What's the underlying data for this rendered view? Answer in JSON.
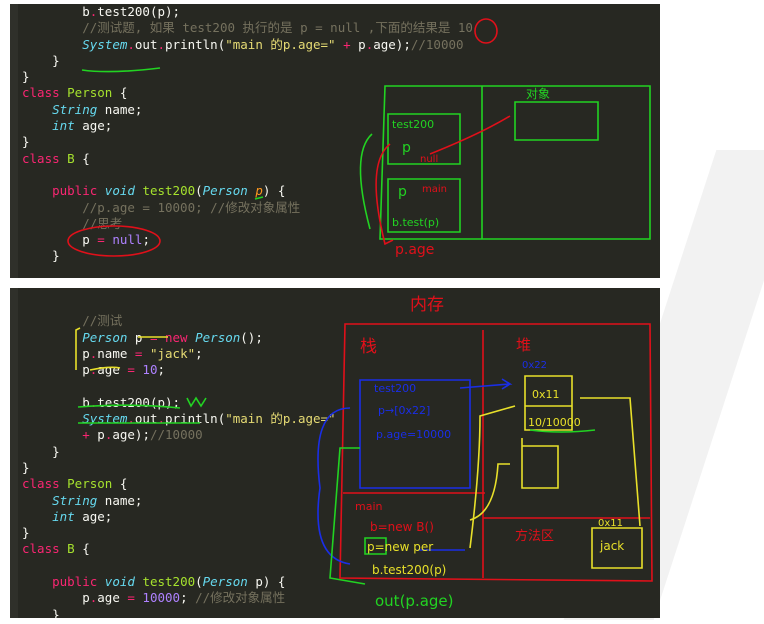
{
  "top_panel": {
    "lines": [
      [
        [
          "        b",
          "t"
        ],
        [
          ".",
          "op"
        ],
        [
          "test200(p);",
          "t"
        ]
      ],
      [
        [
          "        //测试题, 如果 test200 执行的是 p = null ,下面的结果是 ",
          "cm"
        ],
        [
          "10",
          "cm"
        ]
      ],
      [
        [
          "        ",
          "t"
        ],
        [
          "System",
          "ty"
        ],
        [
          ".",
          "op"
        ],
        [
          "out",
          "t"
        ],
        [
          ".",
          "op"
        ],
        [
          "println(",
          "t"
        ],
        [
          "\"main 的p.age=\"",
          "str"
        ],
        [
          " + ",
          "op"
        ],
        [
          "p",
          "t"
        ],
        [
          ".",
          "op"
        ],
        [
          "age);",
          "t"
        ],
        [
          "//10000",
          "cm"
        ]
      ],
      [
        [
          "    }",
          "t"
        ]
      ],
      [
        [
          "}",
          "t"
        ]
      ],
      [
        [
          "class ",
          "kw"
        ],
        [
          "Person",
          "fn"
        ],
        [
          " {",
          "t"
        ]
      ],
      [
        [
          "    ",
          "t"
        ],
        [
          "String",
          "ty"
        ],
        [
          " name;",
          "t"
        ]
      ],
      [
        [
          "    ",
          "t"
        ],
        [
          "int",
          "ty"
        ],
        [
          " age;",
          "t"
        ]
      ],
      [
        [
          "}",
          "t"
        ]
      ],
      [
        [
          "class ",
          "kw"
        ],
        [
          "B",
          "fn"
        ],
        [
          " {",
          "t"
        ]
      ],
      [
        [
          "",
          "t"
        ]
      ],
      [
        [
          "    public ",
          "kw"
        ],
        [
          "void ",
          "ty"
        ],
        [
          "test200",
          "fn"
        ],
        [
          "(",
          "t"
        ],
        [
          "Person ",
          "ty"
        ],
        [
          "p",
          "par"
        ],
        [
          ") {",
          "t"
        ]
      ],
      [
        [
          "        //p.age = 10000; //修改对象属性",
          "cm"
        ]
      ],
      [
        [
          "        //思考",
          "cm"
        ]
      ],
      [
        [
          "        p ",
          "t"
        ],
        [
          "=",
          "op"
        ],
        [
          " null",
          "num"
        ],
        [
          ";",
          "t"
        ]
      ],
      [
        [
          "    }",
          "t"
        ]
      ]
    ],
    "annotations": {
      "object": "对象",
      "frame_test200": "test200",
      "p1": "p",
      "null": "null",
      "p2": "p",
      "main": "main",
      "call": "b.test(p)",
      "page": "p.age"
    }
  },
  "bottom_panel": {
    "lines": [
      [
        [
          "",
          "t"
        ]
      ],
      [
        [
          "        //测试",
          "cm"
        ]
      ],
      [
        [
          "        ",
          "t"
        ],
        [
          "Person",
          "ty"
        ],
        [
          " p ",
          "t"
        ],
        [
          "=",
          "op"
        ],
        [
          " new ",
          "kw"
        ],
        [
          "Person",
          "ty"
        ],
        [
          "();",
          "t"
        ]
      ],
      [
        [
          "        p",
          "t"
        ],
        [
          ".",
          "op"
        ],
        [
          "name ",
          "t"
        ],
        [
          "=",
          "op"
        ],
        [
          " \"jack\"",
          "str"
        ],
        [
          ";",
          "t"
        ]
      ],
      [
        [
          "        p",
          "t"
        ],
        [
          ".",
          "op"
        ],
        [
          "age ",
          "t"
        ],
        [
          "=",
          "op"
        ],
        [
          " 10",
          "num"
        ],
        [
          ";",
          "t"
        ]
      ],
      [
        [
          "",
          "t"
        ]
      ],
      [
        [
          "        b",
          "t"
        ],
        [
          ".",
          "op"
        ],
        [
          "test200(p);",
          "t"
        ]
      ],
      [
        [
          "        ",
          "t"
        ],
        [
          "System",
          "ty"
        ],
        [
          ".",
          "op"
        ],
        [
          "out",
          "t"
        ],
        [
          ".",
          "op"
        ],
        [
          "println(",
          "t"
        ],
        [
          "\"main 的p.age=\"",
          "str"
        ]
      ],
      [
        [
          "        ",
          "op"
        ],
        [
          "+ ",
          "op"
        ],
        [
          "p",
          "t"
        ],
        [
          ".",
          "op"
        ],
        [
          "age);",
          "t"
        ],
        [
          "//10000",
          "cm"
        ]
      ],
      [
        [
          "    }",
          "t"
        ]
      ],
      [
        [
          "}",
          "t"
        ]
      ],
      [
        [
          "class ",
          "kw"
        ],
        [
          "Person",
          "fn"
        ],
        [
          " {",
          "t"
        ]
      ],
      [
        [
          "    ",
          "t"
        ],
        [
          "String",
          "ty"
        ],
        [
          " name;",
          "t"
        ]
      ],
      [
        [
          "    ",
          "t"
        ],
        [
          "int",
          "ty"
        ],
        [
          " age;",
          "t"
        ]
      ],
      [
        [
          "}",
          "t"
        ]
      ],
      [
        [
          "class ",
          "kw"
        ],
        [
          "B",
          "fn"
        ],
        [
          " {",
          "t"
        ]
      ],
      [
        [
          "",
          "t"
        ]
      ],
      [
        [
          "    public ",
          "kw"
        ],
        [
          "void ",
          "ty"
        ],
        [
          "test200",
          "fn"
        ],
        [
          "(",
          "t"
        ],
        [
          "Person ",
          "ty"
        ],
        [
          "p",
          "t"
        ],
        [
          ") {",
          "t"
        ]
      ],
      [
        [
          "        p",
          "t"
        ],
        [
          ".",
          "op"
        ],
        [
          "age ",
          "t"
        ],
        [
          "=",
          "op"
        ],
        [
          " 10000",
          "num"
        ],
        [
          "; ",
          "t"
        ],
        [
          "//修改对象属性",
          "cm"
        ]
      ],
      [
        [
          "    }",
          "t"
        ]
      ]
    ],
    "annotations": {
      "memory": "内存",
      "stack": "栈",
      "heap": "堆",
      "method_area": "方法区",
      "addr_obj": "0x22",
      "field_name_ref": "0x11",
      "field_age": "10/10000",
      "frame_test200": "test200",
      "p_ref": "p→[0x22]",
      "p_age": "p.age=10000",
      "main": "main",
      "b_new": "b=new B()",
      "p_new": "p=new per",
      "call": "b.test200(p)",
      "out": "out(p.age)",
      "str_addr": "0x11",
      "str_val": "jack",
      "checks": "✓✓"
    }
  },
  "colors": {
    "bg": "#272822",
    "red": "#e0101a",
    "green": "#22d322",
    "blue": "#1a2ee6",
    "yellow": "#e8e02a"
  }
}
